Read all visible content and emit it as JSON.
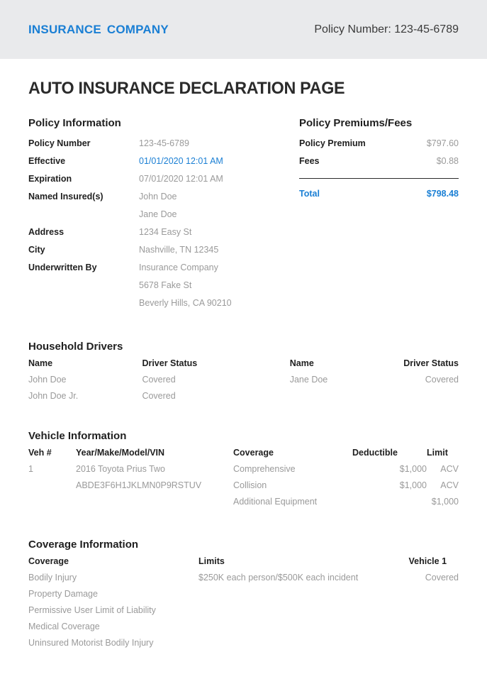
{
  "header": {
    "brand_first": "INSURANCE",
    "brand_second": "COMPANY",
    "policy_number_label": "Policy Number: 123-45-6789",
    "accent_color": "#1a7fd4",
    "band_color": "#e9eaec"
  },
  "document": {
    "title": "AUTO INSURANCE DECLARATION PAGE"
  },
  "policy_information": {
    "heading": "Policy Information",
    "rows": [
      {
        "label": "Policy Number",
        "value": "123-45-6789",
        "accent": false
      },
      {
        "label": "Effective",
        "value": "01/01/2020 12:01 AM",
        "accent": true
      },
      {
        "label": "Expiration",
        "value": "07/01/2020 12:01 AM",
        "accent": false
      },
      {
        "label": "Named Insured(s)",
        "value": "John Doe",
        "accent": false
      },
      {
        "label": "",
        "value": "Jane Doe",
        "accent": false
      },
      {
        "label": "Address",
        "value": "1234 Easy St",
        "accent": false
      },
      {
        "label": "City",
        "value": "Nashville, TN 12345",
        "accent": false
      },
      {
        "label": "Underwritten By",
        "value": "Insurance Company",
        "accent": false
      },
      {
        "label": "",
        "value": "5678 Fake St",
        "accent": false
      },
      {
        "label": "",
        "value": "Beverly Hills, CA 90210",
        "accent": false
      }
    ]
  },
  "policy_premiums": {
    "heading": "Policy Premiums/Fees",
    "rows": [
      {
        "label": "Policy Premium",
        "value": "$797.60"
      },
      {
        "label": "Fees",
        "value": "$0.88"
      }
    ],
    "total_label": "Total",
    "total_value": "$798.48"
  },
  "household_drivers": {
    "heading": "Household Drivers",
    "headers": [
      "Name",
      "Driver Status",
      "Name",
      "Driver Status"
    ],
    "rows": [
      [
        "John Doe",
        "Covered",
        "Jane Doe",
        "Covered"
      ],
      [
        "John Doe Jr.",
        "Covered",
        "",
        ""
      ]
    ]
  },
  "vehicle_information": {
    "heading": "Vehicle Information",
    "headers": [
      "Veh #",
      "Year/Make/Model/VIN",
      "Coverage",
      "Deductible",
      "Limit"
    ],
    "rows": [
      [
        "1",
        "2016 Toyota Prius Two",
        "Comprehensive",
        "$1,000",
        "ACV"
      ],
      [
        "",
        "ABDE3F6H1JKLMN0P9RSTUV",
        "Collision",
        "$1,000",
        "ACV"
      ],
      [
        "",
        "",
        "Additional Equipment",
        "",
        "$1,000"
      ]
    ]
  },
  "coverage_information": {
    "heading": "Coverage Information",
    "headers": [
      "Coverage",
      "Limits",
      "Vehicle 1"
    ],
    "rows": [
      [
        "Bodily Injury",
        "$250K each person/$500K each incident",
        "Covered"
      ],
      [
        "Property Damage",
        "",
        ""
      ],
      [
        "Permissive User Limit of Liability",
        "",
        ""
      ],
      [
        "Medical Coverage",
        "",
        ""
      ],
      [
        "Uninsured Motorist Bodily Injury",
        "",
        ""
      ]
    ]
  }
}
